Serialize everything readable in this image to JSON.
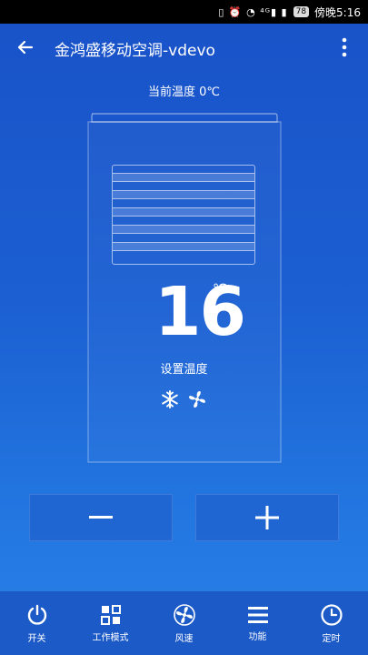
{
  "status_bar": {
    "icons": "▯ ⏰ ◔ ⁴ᴳ▮ ▮",
    "battery": "78",
    "time": "傍晚5:16"
  },
  "app_bar": {
    "title": "金鸿盛移动空调-vdevo",
    "back_icon": "arrow-left-icon",
    "more_icon": "more-vertical-icon"
  },
  "current_temperature": "当前温度 0℃",
  "set_temperature": {
    "value": "16",
    "unit": "℃",
    "label": "设置温度"
  },
  "controls": {
    "minus": "−",
    "plus": "+"
  },
  "bottom_nav": [
    {
      "label": "开关",
      "icon": "power-icon"
    },
    {
      "label": "工作模式",
      "icon": "mode-grid-icon"
    },
    {
      "label": "风速",
      "icon": "fan-icon"
    },
    {
      "label": "功能",
      "icon": "menu-icon"
    },
    {
      "label": "定时",
      "icon": "clock-icon"
    }
  ]
}
